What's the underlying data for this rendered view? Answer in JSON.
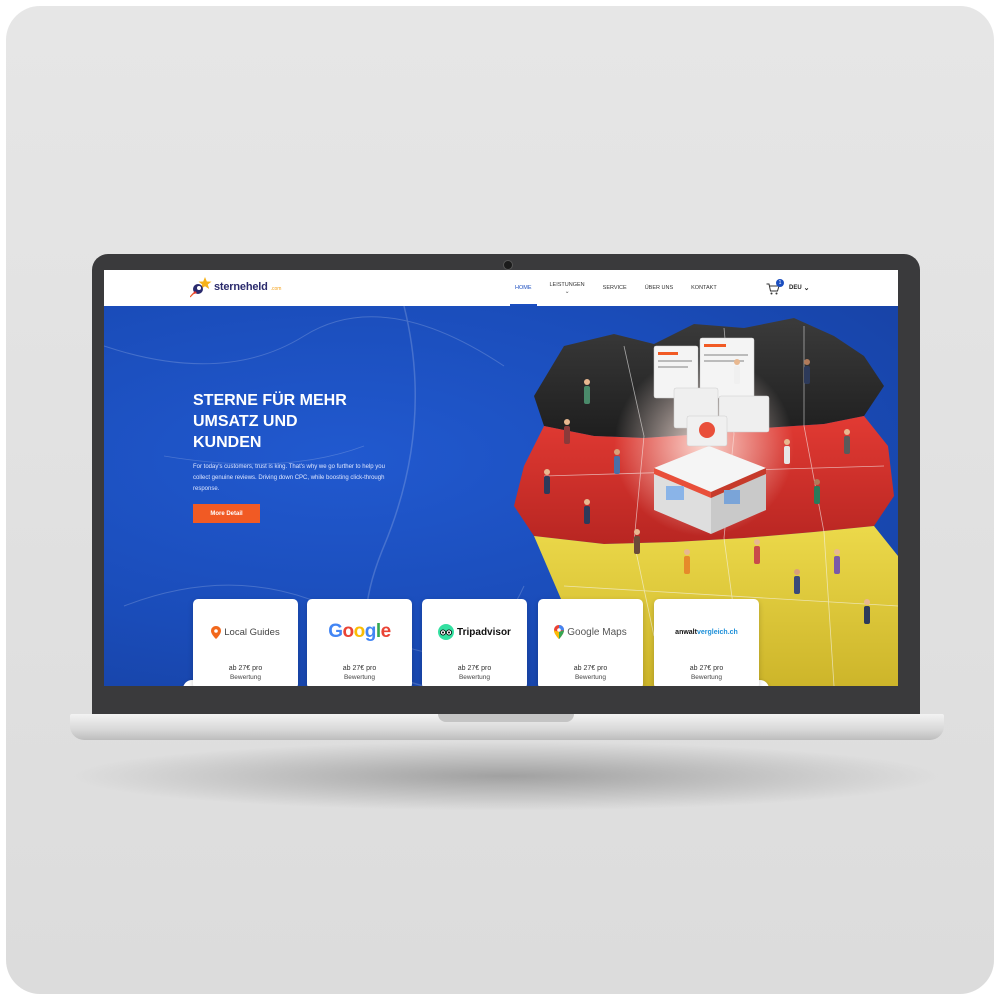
{
  "brand": {
    "name": "sterneheld",
    "tld": ".com"
  },
  "nav": {
    "items": [
      {
        "label": "HOME",
        "active": true
      },
      {
        "label": "LEISTUNGEN",
        "has_caret": true
      },
      {
        "label": "SERVICE"
      },
      {
        "label": "ÜBER UNS"
      },
      {
        "label": "KONTAKT"
      }
    ],
    "cart_count": "1",
    "language": "DEU"
  },
  "hero": {
    "title_lines": [
      "STERNE FÜR MEHR",
      "UMSATZ UND",
      "KUNDEN"
    ],
    "text": "For today's customers, trust is king. That's why we go further to help you collect genuine reviews. Driving down CPC, while boosting click-through response.",
    "button_label": "More Detail"
  },
  "platforms": [
    {
      "name": "Local Guides",
      "price": "ab 27€ pro",
      "unit": "Bewertung"
    },
    {
      "name": "Google",
      "price": "ab 27€ pro",
      "unit": "Bewertung"
    },
    {
      "name": "Tripadvisor",
      "price": "ab 27€ pro",
      "unit": "Bewertung"
    },
    {
      "name": "Google Maps",
      "price": "ab 27€ pro",
      "unit": "Bewertung"
    },
    {
      "name_part1": "anwalt",
      "name_part2": "vergleich.ch",
      "price": "ab 27€ pro",
      "unit": "Bewertung"
    }
  ],
  "carousel": {
    "prev_icon": "‹",
    "next_icon": "›"
  },
  "colors": {
    "primary": "#1b4ec0",
    "accent": "#f15a24",
    "flag_black": "#2a2a2a",
    "flag_red": "#d8302c",
    "flag_gold": "#e7cf3a"
  },
  "icons": [
    "rocket-star-logo-icon",
    "cart-icon",
    "chevron-down-icon",
    "map-pin-icon",
    "owl-icon",
    "maps-pin-icon",
    "arrow-left-icon",
    "arrow-right-icon"
  ]
}
